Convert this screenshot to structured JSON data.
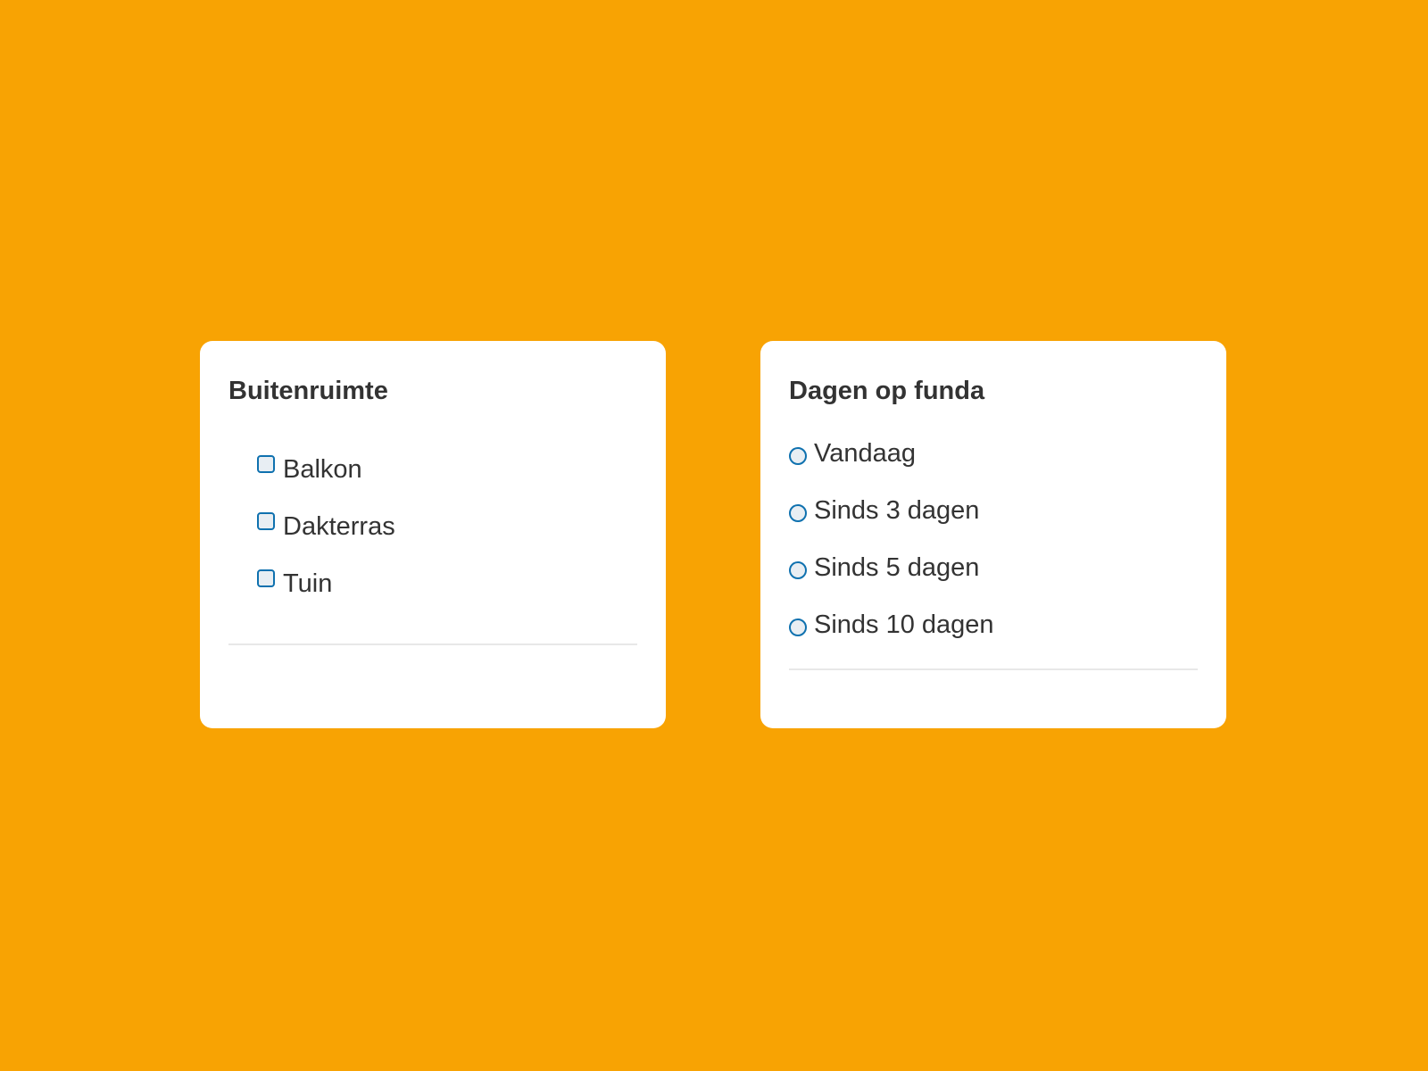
{
  "colors": {
    "background": "#F8A303",
    "card": "#FFFFFF",
    "text": "#333333",
    "control_border": "#0F71AF",
    "control_fill": "#E8EEF3",
    "divider": "#E8E8E8"
  },
  "outdoor_filter": {
    "title": "Buitenruimte",
    "control_type": "checkbox",
    "options": [
      {
        "label": "Balkon",
        "checked": false
      },
      {
        "label": "Dakterras",
        "checked": false
      },
      {
        "label": "Tuin",
        "checked": false
      }
    ]
  },
  "days_filter": {
    "title": "Dagen op funda",
    "control_type": "radio",
    "options": [
      {
        "label": "Vandaag",
        "selected": false
      },
      {
        "label": "Sinds 3 dagen",
        "selected": false
      },
      {
        "label": "Sinds 5 dagen",
        "selected": false
      },
      {
        "label": "Sinds 10 dagen",
        "selected": false
      }
    ]
  }
}
